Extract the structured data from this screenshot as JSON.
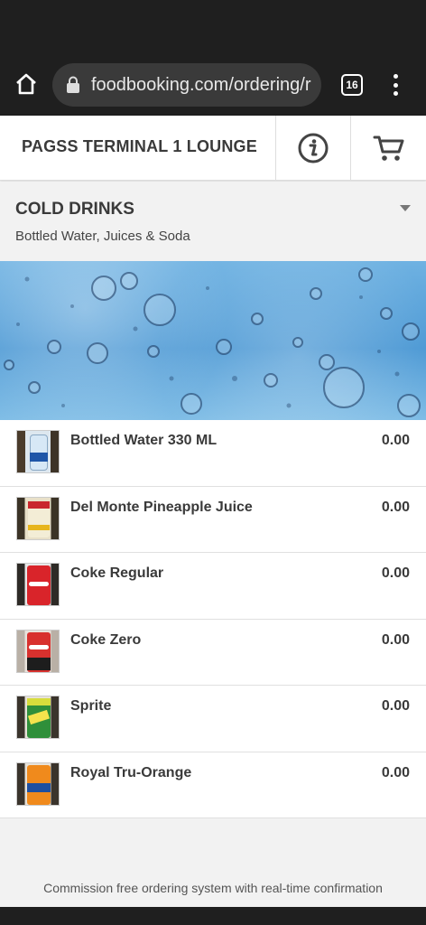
{
  "browser": {
    "url": "foodbooking.com/ordering/r",
    "tab_count": "16"
  },
  "header": {
    "venue_name": "PAGSS TERMINAL 1 LOUNGE"
  },
  "category": {
    "title": "COLD DRINKS",
    "subtitle": "Bottled Water, Juices & Soda"
  },
  "items": [
    {
      "name": "Bottled Water 330 ML",
      "price": "0.00"
    },
    {
      "name": "Del Monte Pineapple Juice",
      "price": "0.00"
    },
    {
      "name": "Coke Regular",
      "price": "0.00"
    },
    {
      "name": "Coke Zero",
      "price": "0.00"
    },
    {
      "name": "Sprite",
      "price": "0.00"
    },
    {
      "name": "Royal Tru-Orange",
      "price": "0.00"
    }
  ],
  "footer": {
    "tagline": "Commission free ordering system with real-time confirmation"
  },
  "colors": {
    "browser_bg": "#1f1f1f",
    "text_dark": "#3a3a3a",
    "banner_blue": "#4b98d4"
  }
}
